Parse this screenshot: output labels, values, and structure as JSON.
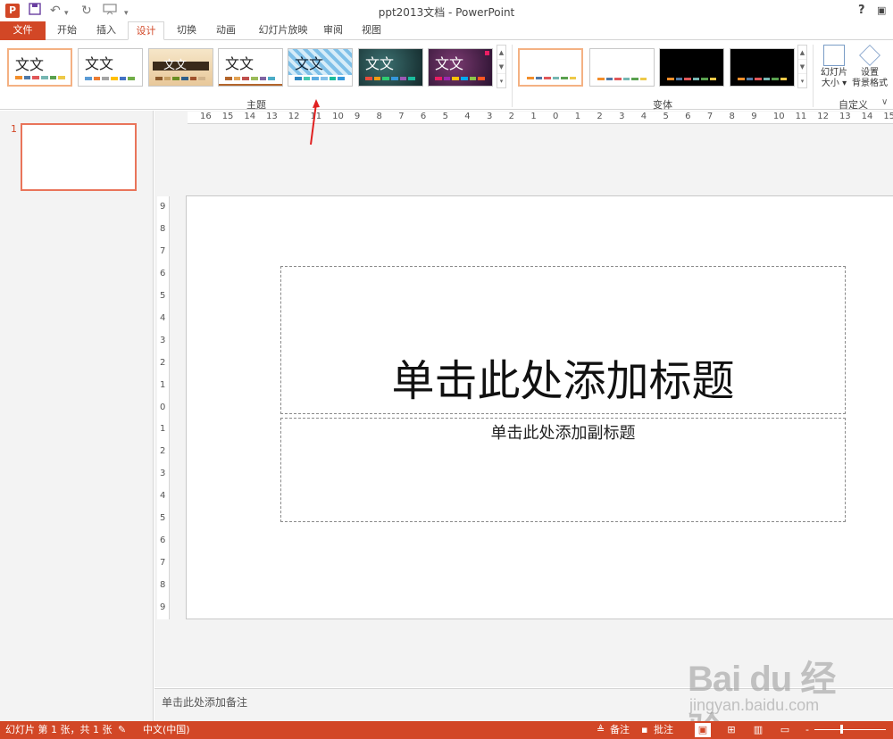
{
  "window": {
    "app_icon": "P",
    "title": "ppt2013文档 - PowerPoint",
    "help": "?"
  },
  "qat": {
    "save_icon": "floppy-disk-icon",
    "undo_icon": "undo-icon",
    "redo_icon": "redo-icon",
    "slideshow_icon": "slideshow-icon"
  },
  "tabs": [
    {
      "label": "文件",
      "file": true
    },
    {
      "label": "开始"
    },
    {
      "label": "插入"
    },
    {
      "label": "设计",
      "active": true
    },
    {
      "label": "切换"
    },
    {
      "label": "动画"
    },
    {
      "label": "幻灯片放映"
    },
    {
      "label": "审阅"
    },
    {
      "label": "视图"
    }
  ],
  "ribbon": {
    "themes_group_label": "主题",
    "variants_group_label": "变体",
    "customize_group_label": "自定义",
    "theme_sample": "文文",
    "slide_size_label_1": "幻灯片",
    "slide_size_label_2": "大小",
    "bg_format_label_1": "设置",
    "bg_format_label_2": "背景格式"
  },
  "theme_colors": [
    [
      "#f28e2b",
      "#4e79a7",
      "#e15759",
      "#76b7b2",
      "#59a14f",
      "#edc948"
    ],
    [
      "#5b9bd5",
      "#ed7d31",
      "#a5a5a5",
      "#ffc000",
      "#4472c4",
      "#70ad47"
    ],
    [
      "#8c5a2b",
      "#c8a165",
      "#6b8e23",
      "#2e5f8a",
      "#a0522d",
      "#d2b48c"
    ],
    [
      "#b3652c",
      "#e3a354",
      "#c0504d",
      "#9bbb59",
      "#8064a2",
      "#4bacc6"
    ],
    [
      "#2e86c1",
      "#48c9b0",
      "#5dade2",
      "#85c1e9",
      "#1abc9c",
      "#3498db"
    ],
    [
      "#e74c3c",
      "#f39c12",
      "#2ecc71",
      "#3498db",
      "#9b59b6",
      "#1abc9c"
    ],
    [
      "#e91e63",
      "#9c27b0",
      "#ffc107",
      "#03a9f4",
      "#8bc34a",
      "#ff5722"
    ]
  ],
  "left_pane": {
    "slide_number": "1"
  },
  "slide": {
    "title_placeholder": "单击此处添加标题",
    "subtitle_placeholder": "单击此处添加副标题"
  },
  "notes": {
    "placeholder": "单击此处添加备注"
  },
  "status_bar": {
    "slide_info": "幻灯片 第 1 张，共 1 张",
    "language": "中文(中国)",
    "notes_label": "备注",
    "comments_label": "批注",
    "zoom_minus": "-"
  },
  "rulers": {
    "horizontal_ticks": [
      "16",
      "15",
      "14",
      "13",
      "12",
      "11",
      "10",
      "9",
      "8",
      "7",
      "6",
      "5",
      "4",
      "3",
      "2",
      "1",
      "0",
      "1",
      "2",
      "3",
      "4",
      "5",
      "6",
      "7",
      "8",
      "9",
      "10",
      "11",
      "12",
      "13",
      "14",
      "15"
    ],
    "vertical_ticks": [
      "9",
      "8",
      "7",
      "6",
      "5",
      "4",
      "3",
      "2",
      "1",
      "0",
      "1",
      "2",
      "3",
      "4",
      "5",
      "6",
      "7",
      "8",
      "9"
    ]
  },
  "watermark": {
    "brand": "Bai du 经验",
    "url": "jingyan.baidu.com"
  }
}
